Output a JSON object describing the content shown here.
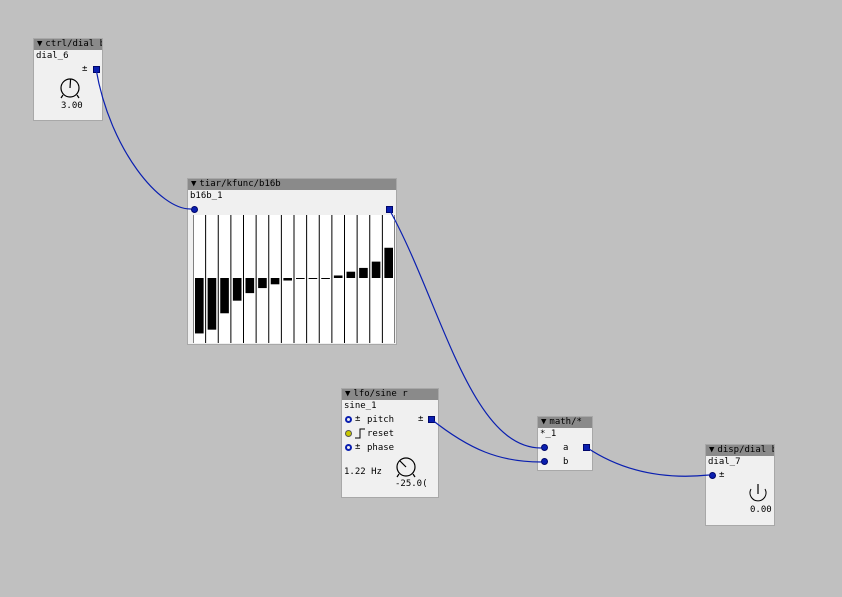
{
  "objects": {
    "dial6": {
      "type": "ctrl/dial b",
      "instance": "dial_6",
      "pm": "±",
      "value": "3.00"
    },
    "b16b": {
      "type": "tiar/kfunc/b16b",
      "instance": "b16b_1",
      "bars": [
        -0.88,
        -0.82,
        -0.56,
        -0.36,
        -0.24,
        -0.16,
        -0.1,
        -0.04,
        0,
        0,
        0,
        0.04,
        0.1,
        0.16,
        0.26,
        0.48
      ]
    },
    "lfo": {
      "type": "lfo/sine r",
      "instance": "sine_1",
      "inlets": [
        {
          "pm": "±",
          "label": "pitch"
        },
        {
          "pm": "⌐",
          "label": "reset"
        },
        {
          "pm": "±",
          "label": "phase"
        }
      ],
      "outlet_pm": "±",
      "freq": "1.22 Hz",
      "dial_value": "-25.0("
    },
    "mul": {
      "type": "math/*",
      "instance": "*_1",
      "inlet_a": "a",
      "inlet_b": "b"
    },
    "disp": {
      "type": "disp/dial b",
      "instance": "dial_7",
      "pm": "±",
      "value": "0.00"
    }
  },
  "colors": {
    "background": "#c0c0c0",
    "header": "#8a8a8a",
    "wire": "#0a1fb0",
    "body": "#f0f0f0"
  }
}
